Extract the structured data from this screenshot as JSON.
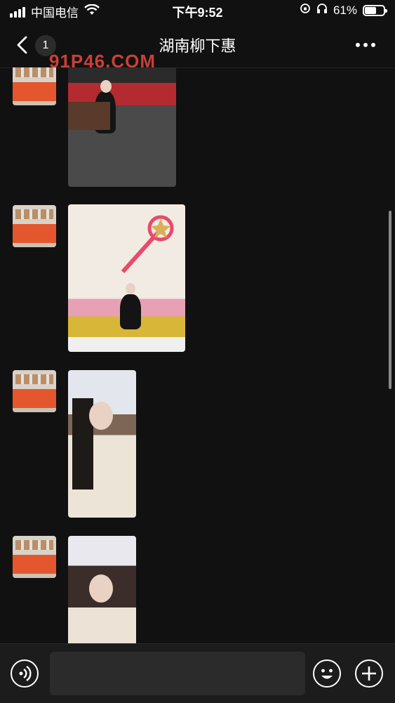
{
  "status_bar": {
    "carrier": "中国电信",
    "time": "下午9:52",
    "battery_percent": "61%",
    "battery_level": 0.61,
    "signal_bars": 4,
    "icons": [
      "signal-icon",
      "wifi-icon",
      "orientation-lock-icon",
      "headphones-icon",
      "battery-icon"
    ]
  },
  "nav": {
    "unread_count": "1",
    "title": "湖南柳下惠",
    "icons": [
      "back-icon",
      "more-icon"
    ]
  },
  "watermark": {
    "text": "91P46.COM",
    "color": "#e0443a"
  },
  "messages": [
    {
      "type": "image",
      "sender": "other",
      "description_icon": "photo-woman-sitting-on-bench"
    },
    {
      "type": "image",
      "sender": "other",
      "description_icon": "photo-woman-with-umbrella-and-wand-mural"
    },
    {
      "type": "image",
      "sender": "other",
      "description_icon": "photo-woman-peace-sign"
    },
    {
      "type": "image",
      "sender": "other",
      "description_icon": "photo-woman-portrait"
    }
  ],
  "input_bar": {
    "message_value": "",
    "icons": [
      "voice-icon",
      "emoji-icon",
      "plus-icon"
    ]
  },
  "colors": {
    "background": "#111111",
    "input_bar": "#1c1c1c",
    "input_field": "#2b2b2b",
    "watermark": "#e0443a"
  }
}
